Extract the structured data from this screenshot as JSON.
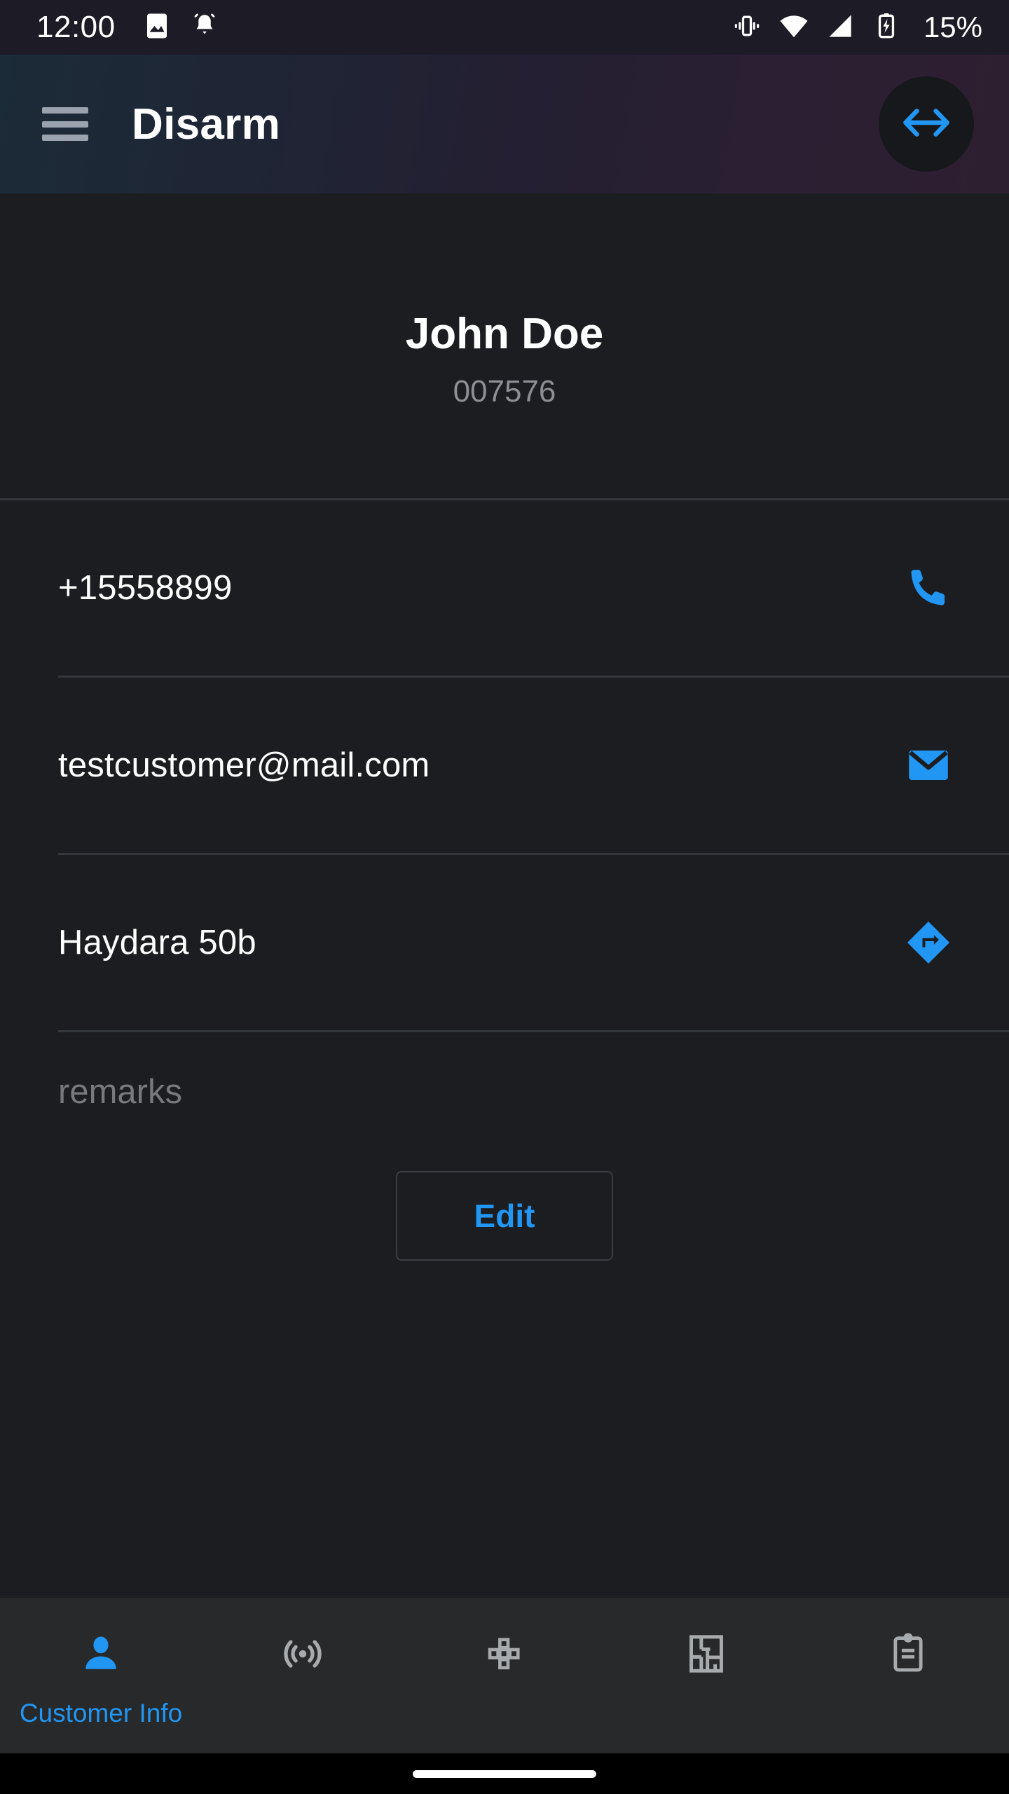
{
  "status_bar": {
    "clock": "12:00",
    "battery_percent": "15%",
    "icons": {
      "photo": "photo-icon",
      "alarm_bell": "alarm-bell-icon",
      "vibrate": "vibrate-icon",
      "wifi": "wifi-icon",
      "signal": "cellular-signal-icon",
      "battery_charging": "battery-charging-icon"
    }
  },
  "app_bar": {
    "title": "Disarm",
    "menu_icon": "hamburger-menu-icon",
    "action_icon": "arrows-left-right-icon"
  },
  "customer": {
    "name": "John Doe",
    "id": "007576",
    "rows": [
      {
        "text": "+15558899",
        "icon": "phone-icon",
        "action": "call"
      },
      {
        "text": "testcustomer@mail.com",
        "icon": "email-icon",
        "action": "email"
      },
      {
        "text": "Haydara 50b",
        "icon": "directions-icon",
        "action": "navigate"
      }
    ],
    "remarks_placeholder": "remarks",
    "edit_label": "Edit"
  },
  "bottom_nav": {
    "items": [
      {
        "label": "Customer Info",
        "icon": "person-icon",
        "active": true
      },
      {
        "label": "",
        "icon": "motion-sensor-icon",
        "active": false
      },
      {
        "label": "",
        "icon": "keypad-zones-icon",
        "active": false
      },
      {
        "label": "",
        "icon": "floor-plan-icon",
        "active": false
      },
      {
        "label": "",
        "icon": "clipboard-icon",
        "active": false
      }
    ]
  },
  "colors": {
    "accent": "#2196f3",
    "background": "#1b1d20",
    "nav_background": "#27292b",
    "divider": "#34383d",
    "muted_text": "#8c8f93",
    "inactive_icon": "#a8abae"
  }
}
